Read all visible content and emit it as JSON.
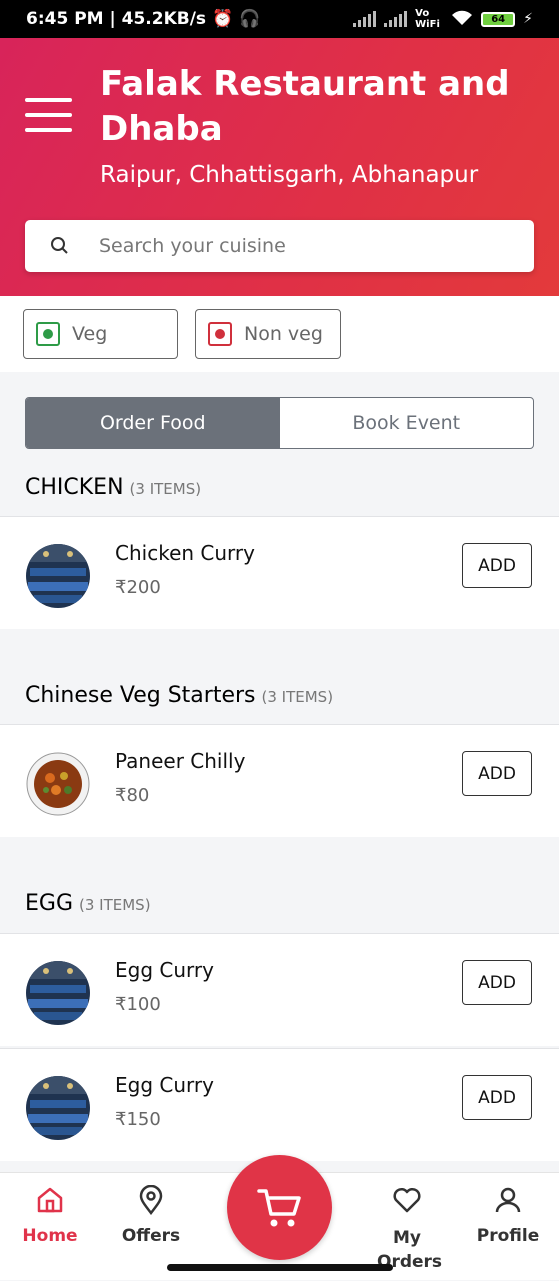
{
  "status_bar": {
    "time_speed": "6:45 PM | 45.2KB/s",
    "network_label": "Vo WiFi",
    "battery": "64"
  },
  "header": {
    "restaurant_name": "Falak Restaurant and Dhaba",
    "location": "Raipur, Chhattisgarh, Abhanapur",
    "background_color": "#e03046"
  },
  "search": {
    "placeholder": "Search your cuisine",
    "value": ""
  },
  "filters": {
    "veg_label": "Veg",
    "nonveg_label": "Non veg",
    "veg_color": "#2e9b47",
    "nonveg_color": "#d0303c"
  },
  "mode_toggle": {
    "order_label": "Order Food",
    "event_label": "Book Event",
    "selected": "Order Food"
  },
  "categories": [
    {
      "title": "CHICKEN",
      "count": "(3 ITEMS)",
      "items": [
        {
          "name": "Chicken Curry",
          "price": "₹200",
          "add_label": "ADD",
          "image": "restaurant-interior"
        }
      ]
    },
    {
      "title": "Chinese Veg Starters",
      "count": "(3 ITEMS)",
      "items": [
        {
          "name": "Paneer Chilly",
          "price": "₹80",
          "add_label": "ADD",
          "image": "paneer-dish"
        }
      ]
    },
    {
      "title": "EGG",
      "count": "(3 ITEMS)",
      "items": [
        {
          "name": "Egg Curry",
          "price": "₹100",
          "add_label": "ADD",
          "image": "restaurant-interior"
        },
        {
          "name": "Egg Curry",
          "price": "₹150",
          "add_label": "ADD",
          "image": "restaurant-interior"
        }
      ]
    }
  ],
  "bottom_nav": {
    "home": "Home",
    "offers": "Offers",
    "my_orders": "My Orders",
    "profile": "Profile",
    "active": "Home",
    "accent_color": "#e0334a"
  }
}
